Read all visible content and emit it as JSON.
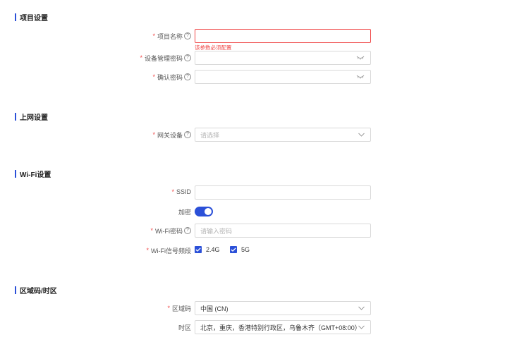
{
  "sections": {
    "project": "项目设置",
    "network": "上网设置",
    "wifi": "Wi-Fi设置",
    "region": "区域码/时区"
  },
  "project": {
    "name_label": "项目名称",
    "name_value": "",
    "name_error": "该参数必须配置",
    "mgmt_pwd_label": "设备管理密码",
    "mgmt_pwd_value": "",
    "confirm_pwd_label": "确认密码",
    "confirm_pwd_value": ""
  },
  "network": {
    "gateway_label": "网关设备",
    "gateway_placeholder": "请选择"
  },
  "wifi": {
    "ssid_label": "SSID",
    "ssid_value": "",
    "encrypt_label": "加密",
    "encrypt_on": true,
    "password_label": "Wi-Fi密码",
    "password_placeholder": "请输入密码",
    "band_label": "Wi-Fi信号频段",
    "band_24": "2.4G",
    "band_5": "5G",
    "band_24_checked": true,
    "band_5_checked": true
  },
  "region": {
    "code_label": "区域码",
    "code_value": "中国 (CN)",
    "tz_label": "时区",
    "tz_value": "北京，重庆，香港特别行政区，乌鲁木齐（GMT+08:00）"
  },
  "colors": {
    "accent": "#2b50d8",
    "error": "#f04848",
    "border": "#d9d9d9"
  },
  "icons": {
    "help": "question-circle-icon",
    "eye": "eye-closed-icon",
    "dropdown": "chevron-down-icon",
    "check": "checkmark-icon"
  }
}
